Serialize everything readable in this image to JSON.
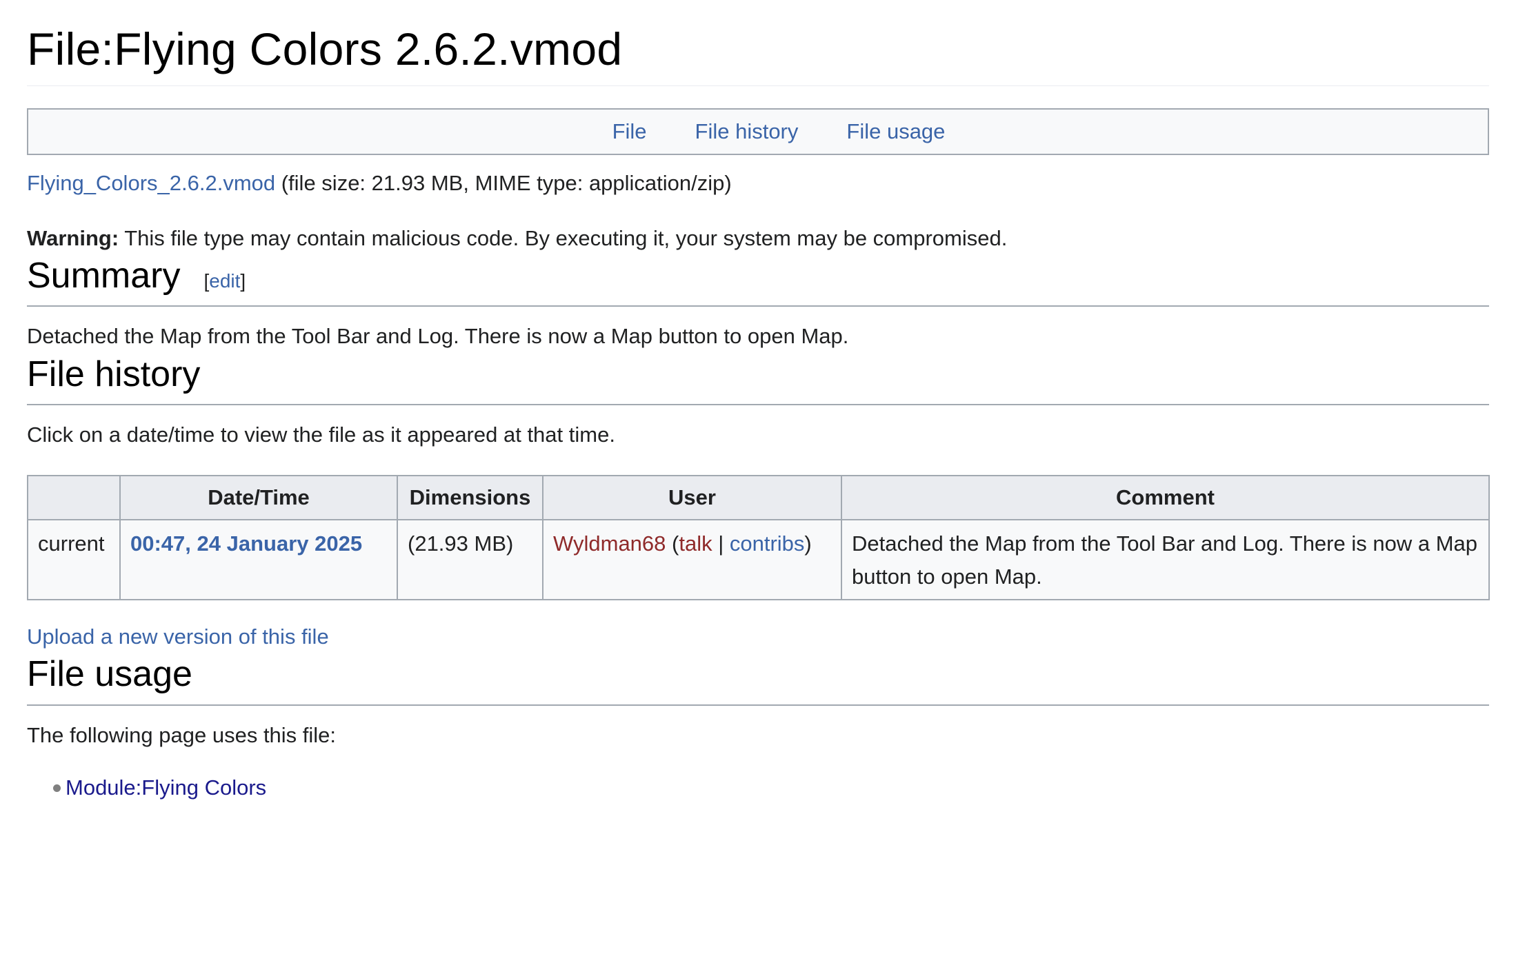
{
  "page": {
    "title": "File:Flying Colors 2.6.2.vmod"
  },
  "filetoc": {
    "items": [
      {
        "label": "File"
      },
      {
        "label": "File history"
      },
      {
        "label": "File usage"
      }
    ]
  },
  "full_media": {
    "link_text": "Flying_Colors_2.6.2.vmod",
    "details": " (file size: 21.93 MB, MIME type: application/zip)"
  },
  "warning": {
    "label": "Warning:",
    "text": " This file type may contain malicious code. By executing it, your system may be compromised."
  },
  "summary": {
    "heading": "Summary",
    "edit_open": "[",
    "edit_label": "edit",
    "edit_close": "]",
    "text": "Detached the Map from the Tool Bar and Log. There is now a Map button to open Map."
  },
  "file_history": {
    "heading": "File history",
    "instruction": "Click on a date/time to view the file as it appeared at that time.",
    "columns": [
      "",
      "Date/Time",
      "Dimensions",
      "User",
      "Comment"
    ],
    "rows": [
      {
        "status": "current",
        "datetime": "00:47, 24 January 2025",
        "dimensions": "(21.93 MB)",
        "user": "Wyldman68",
        "open_paren": " (",
        "talk": "talk",
        "sep": " | ",
        "contribs": "contribs",
        "close_paren": ")",
        "comment": "Detached the Map from the Tool Bar and Log. There is now a Map button to open Map."
      }
    ],
    "upload_link": "Upload a new version of this file"
  },
  "file_usage": {
    "heading": "File usage",
    "intro": "The following page uses this file:",
    "pages": [
      {
        "label": "Module:Flying Colors"
      }
    ]
  },
  "colors": {
    "link": "#3a64a8",
    "user_link": "#8f2a2a",
    "visited_link": "#1a1a8c",
    "table_header_bg": "#eaecf0",
    "table_bg": "#f8f9fa",
    "border": "#a2a9b1"
  }
}
